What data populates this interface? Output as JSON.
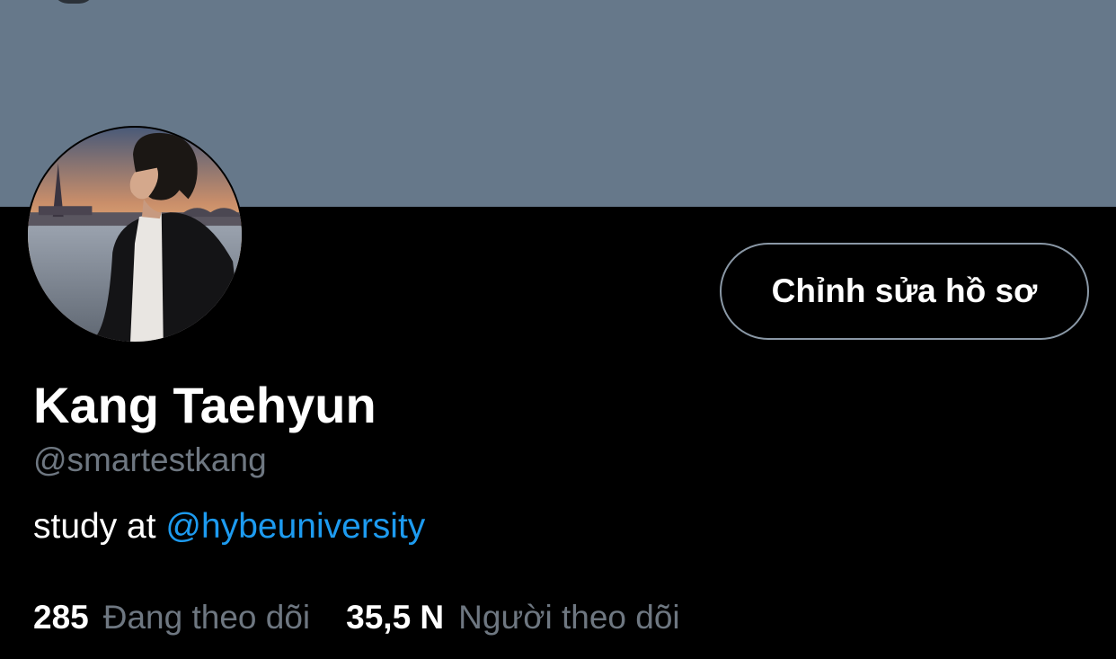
{
  "profile": {
    "display_name": "Kang Taehyun",
    "handle": "@smartestkang",
    "bio_text": "study at ",
    "bio_mention": "@hybeuniversity",
    "edit_button_label": "Chỉnh sửa hồ sơ"
  },
  "stats": {
    "following_count": "285",
    "following_label": "Đang theo dõi",
    "followers_count": "35,5 N",
    "followers_label": "Người theo dõi"
  },
  "colors": {
    "banner": "#66788a",
    "background": "#000000",
    "secondary_text": "#6e7781",
    "link": "#1d9bf0",
    "button_border": "#8a98a6"
  }
}
